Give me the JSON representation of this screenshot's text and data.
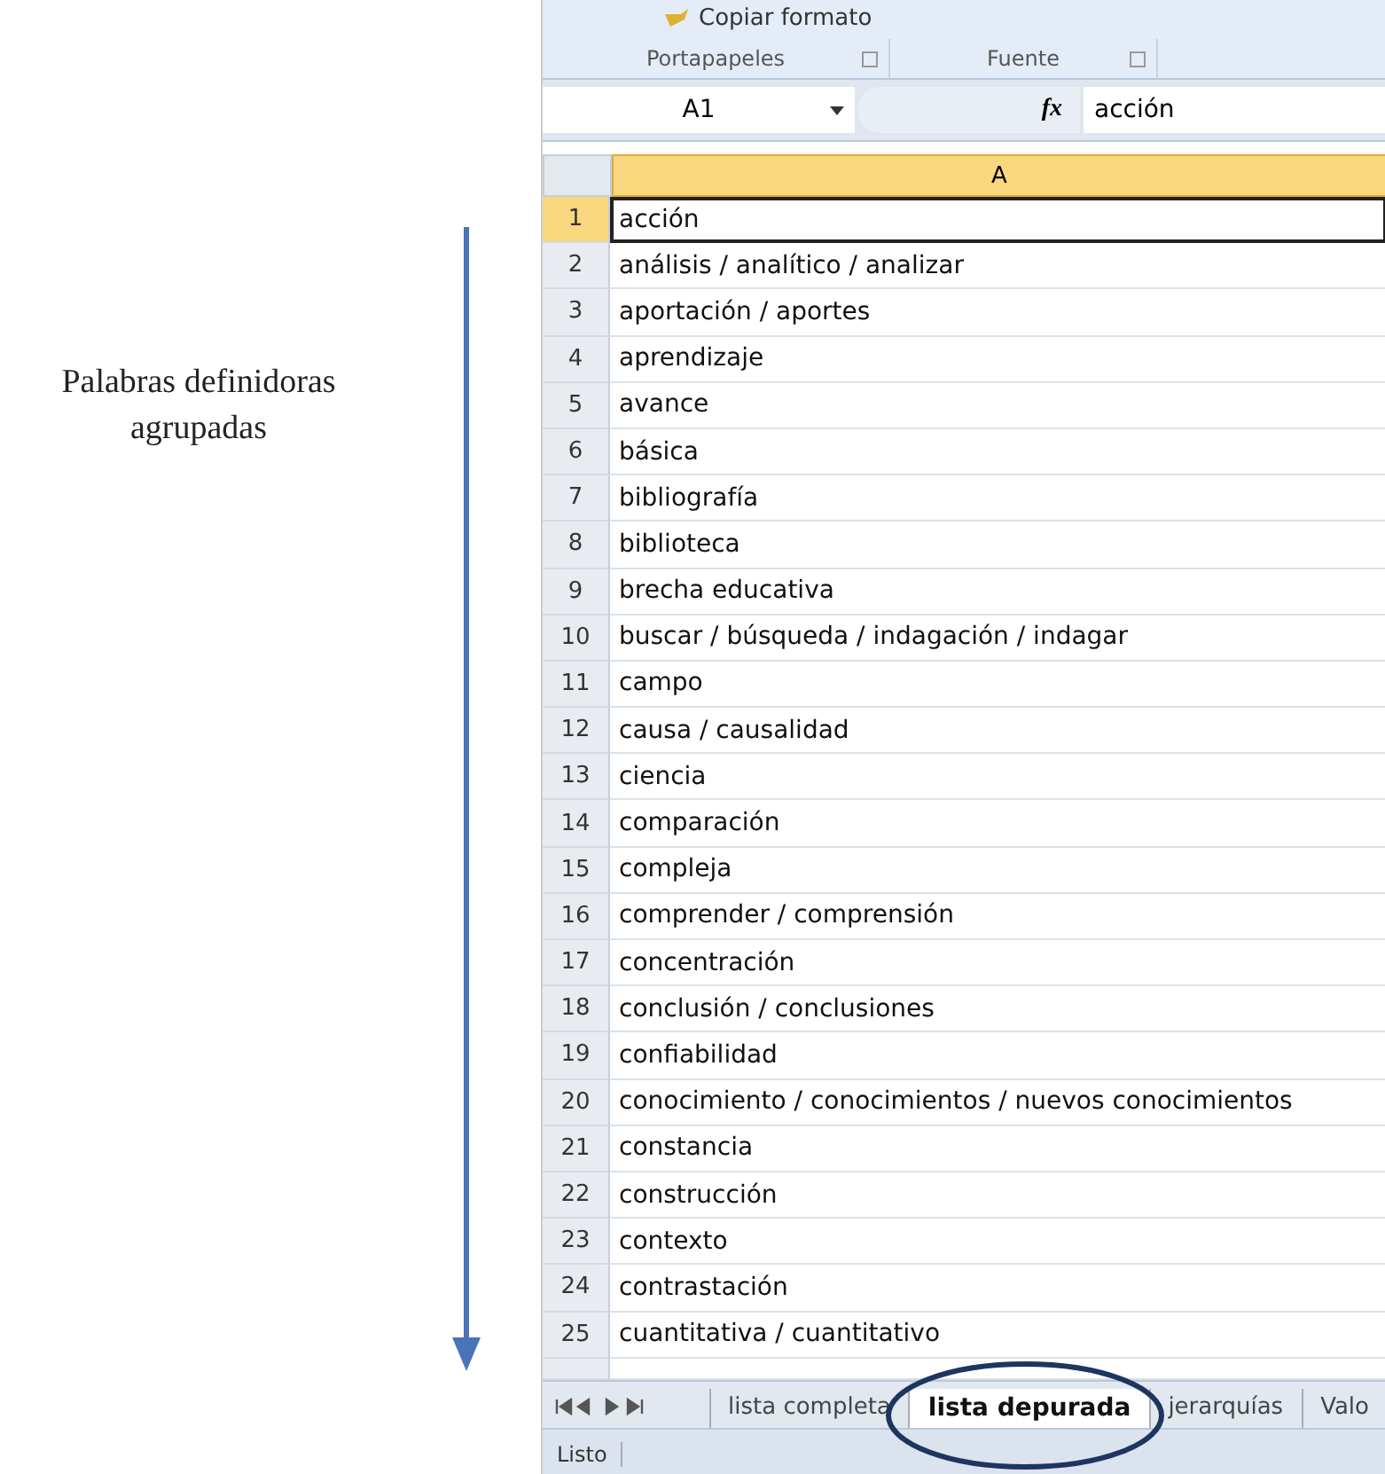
{
  "annotation": {
    "label": "Palabras definidoras agrupadas"
  },
  "ribbon": {
    "command": "Copiar formato",
    "groups": [
      "Portapapeles",
      "Fuente"
    ]
  },
  "formula_bar": {
    "name_box": "A1",
    "fx": "fx",
    "value": "acción"
  },
  "sheet": {
    "column": "A",
    "rows": [
      {
        "n": "1",
        "text": "acción",
        "selected": true
      },
      {
        "n": "2",
        "text": "análisis / analítico / analizar",
        "selected": false
      },
      {
        "n": "3",
        "text": "aportación / aportes",
        "selected": false
      },
      {
        "n": "4",
        "text": "aprendizaje",
        "selected": false
      },
      {
        "n": "5",
        "text": "avance",
        "selected": false
      },
      {
        "n": "6",
        "text": "básica",
        "selected": false
      },
      {
        "n": "7",
        "text": "bibliografía",
        "selected": false
      },
      {
        "n": "8",
        "text": "biblioteca",
        "selected": false
      },
      {
        "n": "9",
        "text": "brecha educativa",
        "selected": false
      },
      {
        "n": "10",
        "text": "buscar / búsqueda / indagación / indagar",
        "selected": false
      },
      {
        "n": "11",
        "text": "campo",
        "selected": false
      },
      {
        "n": "12",
        "text": "causa / causalidad",
        "selected": false
      },
      {
        "n": "13",
        "text": "ciencia",
        "selected": false
      },
      {
        "n": "14",
        "text": "comparación",
        "selected": false
      },
      {
        "n": "15",
        "text": "compleja",
        "selected": false
      },
      {
        "n": "16",
        "text": "comprender / comprensión",
        "selected": false
      },
      {
        "n": "17",
        "text": "concentración",
        "selected": false
      },
      {
        "n": "18",
        "text": "conclusión / conclusiones",
        "selected": false
      },
      {
        "n": "19",
        "text": "confiabilidad",
        "selected": false
      },
      {
        "n": "20",
        "text": "conocimiento / conocimientos / nuevos conocimientos",
        "selected": false
      },
      {
        "n": "21",
        "text": "constancia",
        "selected": false
      },
      {
        "n": "22",
        "text": "construcción",
        "selected": false
      },
      {
        "n": "23",
        "text": "contexto",
        "selected": false
      },
      {
        "n": "24",
        "text": "contrastación",
        "selected": false
      },
      {
        "n": "25",
        "text": "cuantitativa / cuantitativo",
        "selected": false
      }
    ]
  },
  "sheet_tabs": [
    {
      "label": "lista completa",
      "selected": false
    },
    {
      "label": "lista depurada",
      "selected": true
    },
    {
      "label": "jerarquías",
      "selected": false
    },
    {
      "label": "Valo",
      "selected": false
    }
  ],
  "status_bar": {
    "text": "Listo"
  }
}
